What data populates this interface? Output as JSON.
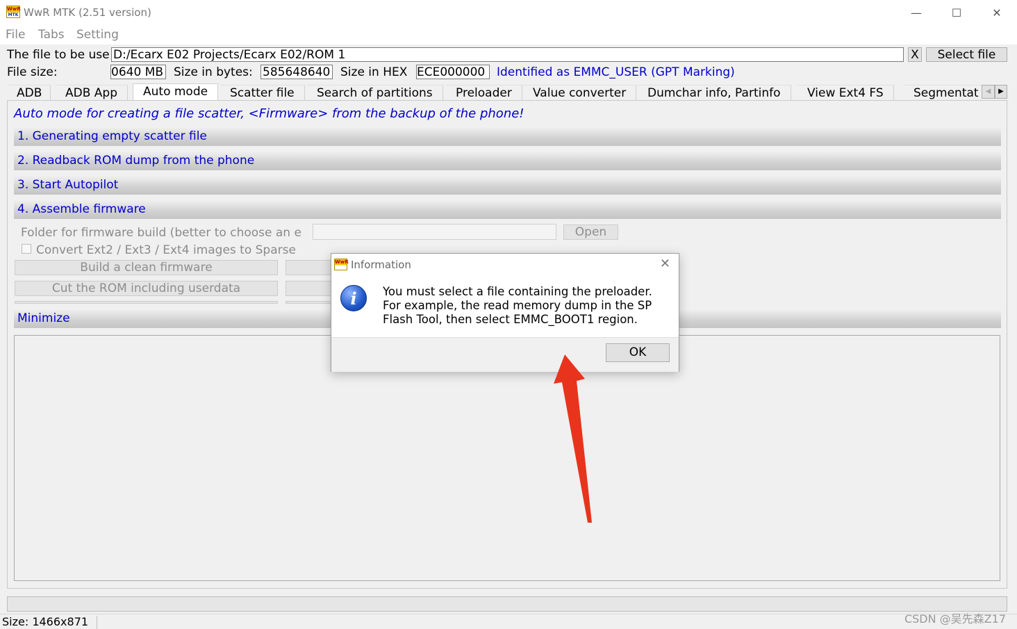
{
  "window": {
    "title": "WwR MTK (2.51 version)",
    "icon_top": "WwR",
    "icon_bottom": "MTK",
    "minimize": "—",
    "maximize": "☐",
    "close": "✕"
  },
  "menu": [
    "File",
    "Tabs",
    "Setting"
  ],
  "file_row": {
    "label": "The file to be use",
    "path": "D:/Ecarx E02 Projects/Ecarx E02/ROM 1",
    "clear_label": "X",
    "select_label": "Select file"
  },
  "size_row": {
    "file_size_label": "File size:",
    "file_size_value": "0640 MB",
    "bytes_label": "Size in bytes:",
    "bytes_value": "585648640",
    "hex_label": "Size in HEX",
    "hex_value": "ECE000000",
    "identified": "Identified as EMMC_USER (GPT Marking)"
  },
  "tabs": [
    "ADB",
    "ADB App",
    "Auto mode",
    "Scatter file",
    "Search of partitions",
    "Preloader",
    "Value converter",
    "Dumchar  info, Partinfo",
    "View Ext4  FS",
    "Segmentat"
  ],
  "active_tab": "Auto mode",
  "tab_scroll_left": "◀",
  "tab_scroll_right": "▶",
  "auto": {
    "heading": "Auto mode for creating a file scatter, <Firmware> from the backup of the phone!",
    "sections": [
      "1. Generating empty scatter file",
      "2. Readback ROM dump from the phone",
      "3. Start Autopilot",
      "4. Assemble firmware"
    ],
    "folder_label": "Folder for firmware build (better to choose an e",
    "open_label": "Open",
    "convert_label": "Convert Ext2 / Ext3 / Ext4 images to Sparse",
    "build_clean_label": "Build a clean firmware",
    "cut_rom_label": "Cut the ROM including userdata",
    "minimize_label": "Minimize"
  },
  "status": {
    "size": "Size: 1466x871"
  },
  "watermark": "CSDN @吴先森Z17",
  "dialog": {
    "title": "Information",
    "close": "✕",
    "icon_letter": "i",
    "message_lines": [
      "You must select a file containing the preloader.",
      "For example, the read memory dump in the SP",
      "Flash Tool, then select EMMC_BOOT1 region."
    ],
    "ok_label": "OK"
  },
  "colors": {
    "link_blue": "#0000cc",
    "annotation_arrow": "#e8341c"
  }
}
